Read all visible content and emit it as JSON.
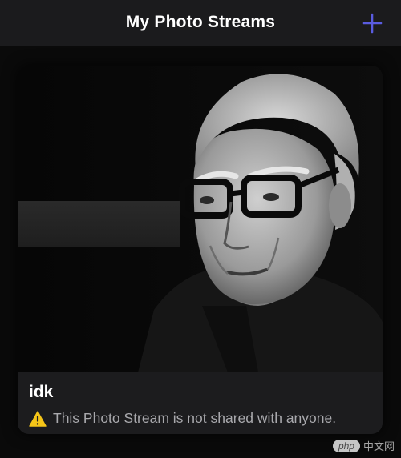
{
  "navbar": {
    "title": "My Photo Streams",
    "add_icon": "plus-icon",
    "accent_color": "#5a5ce0"
  },
  "stream": {
    "name": "idk",
    "status_icon": "warning-icon",
    "status_text": "This Photo Stream is not shared with anyone."
  },
  "watermark": {
    "badge": "php",
    "text": "中文网"
  }
}
